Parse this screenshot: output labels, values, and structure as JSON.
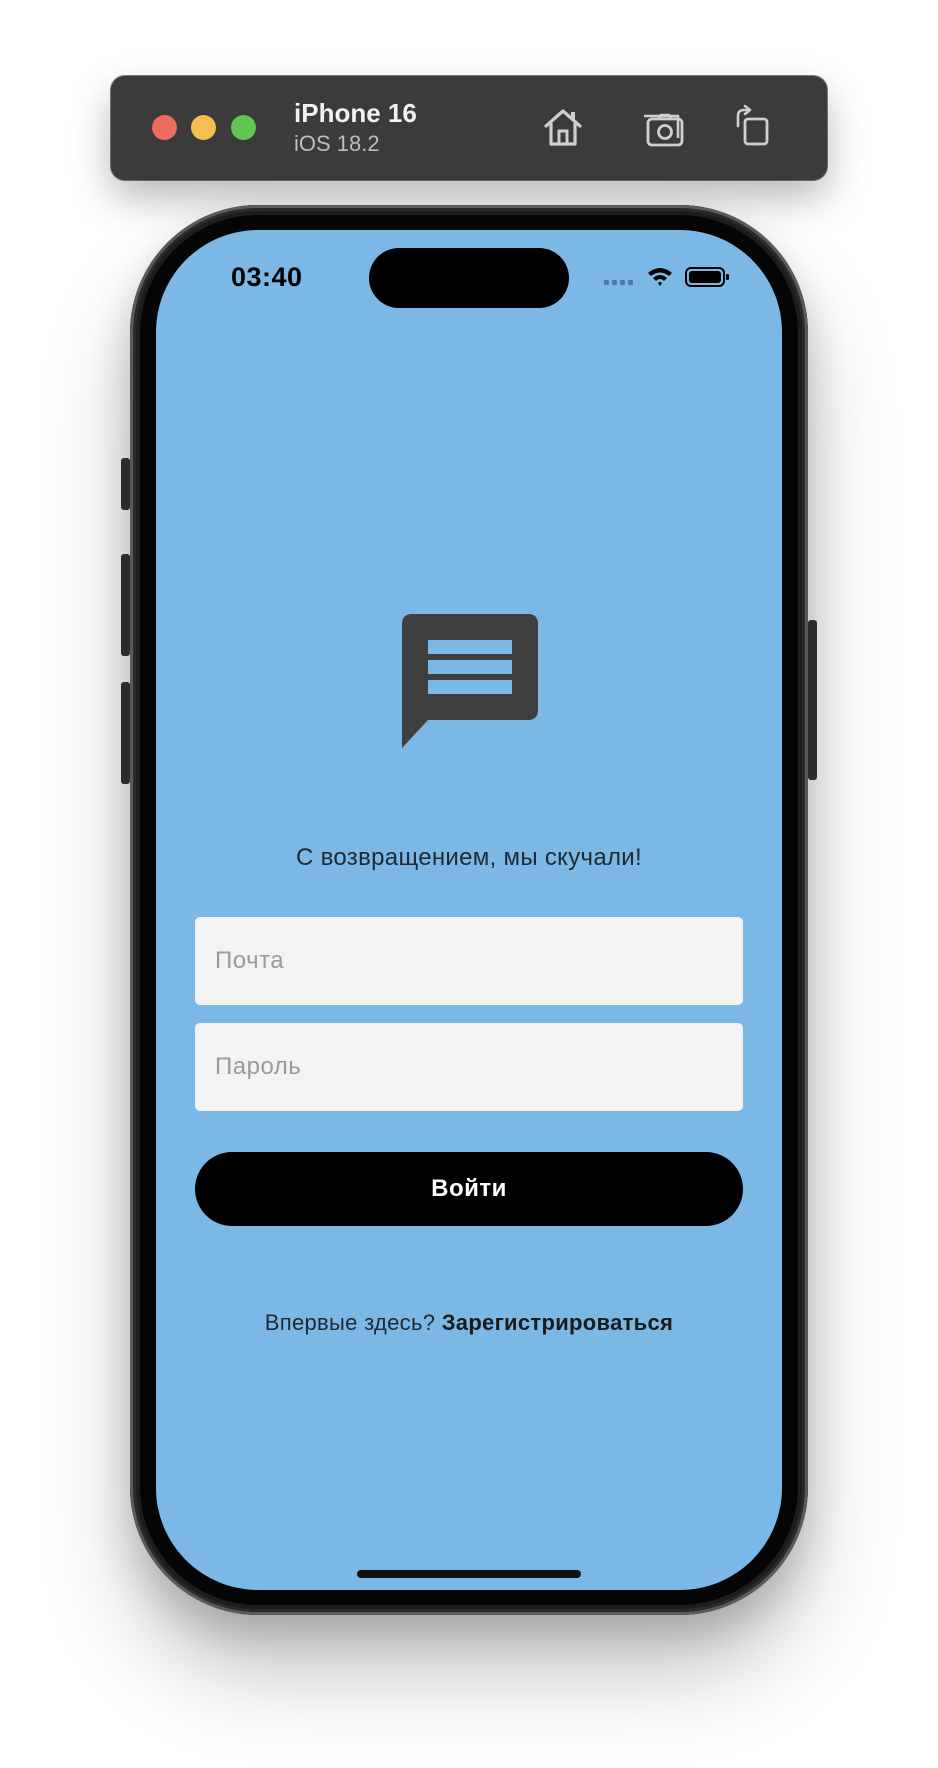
{
  "simulator": {
    "device_name": "iPhone 16",
    "os_version": "iOS 18.2",
    "toolbar_icons": [
      "home-icon",
      "screenshot-icon",
      "rotate-icon"
    ]
  },
  "status_bar": {
    "time": "03:40",
    "icons": [
      "cellular-signal-icon",
      "wifi-icon",
      "battery-icon"
    ]
  },
  "app": {
    "logo_icon": "chat-bubble-icon",
    "welcome_text": "С возвращением, мы скучали!",
    "email_placeholder": "Почта",
    "password_placeholder": "Пароль",
    "login_label": "Войти",
    "register_prompt": "Впервые здесь?",
    "register_link": "Зарегистрироваться"
  },
  "colors": {
    "screen_background": "#7bb8e5",
    "field_background": "#f3f3f3",
    "button_background": "#000000",
    "logo_color": "#3f3f3f"
  }
}
